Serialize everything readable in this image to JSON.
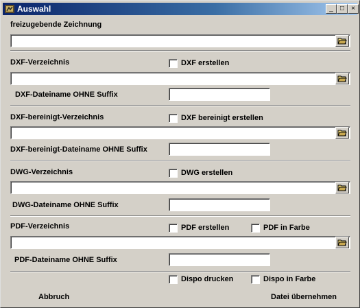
{
  "window": {
    "title": "Auswahl",
    "buttons": {
      "minimize": "_",
      "maximize": "□",
      "close": "×"
    }
  },
  "sections": {
    "zeichnung": {
      "label": "freizugebende Zeichnung",
      "path_value": ""
    },
    "dxf": {
      "dir_label": "DXF-Verzeichnis",
      "create_label": "DXF erstellen",
      "create_checked": false,
      "path_value": "",
      "filename_label": "DXF-Dateiname OHNE Suffix",
      "filename_value": ""
    },
    "dxf_bereinigt": {
      "dir_label": "DXF-bereinigt-Verzeichnis",
      "create_label": "DXF bereinigt erstellen",
      "create_checked": false,
      "path_value": "",
      "filename_label": "DXF-bereinigt-Dateiname OHNE Suffix",
      "filename_value": ""
    },
    "dwg": {
      "dir_label": "DWG-Verzeichnis",
      "create_label": "DWG erstellen",
      "create_checked": false,
      "path_value": "",
      "filename_label": "DWG-Dateiname OHNE Suffix",
      "filename_value": ""
    },
    "pdf": {
      "dir_label": "PDF-Verzeichnis",
      "create_label": "PDF erstellen",
      "create_checked": false,
      "color_label": "PDF in Farbe",
      "color_checked": false,
      "path_value": "",
      "filename_label": "PDF-Dateiname OHNE Suffix",
      "filename_value": ""
    }
  },
  "dispo": {
    "print_label": "Dispo drucken",
    "print_checked": false,
    "color_label": "Dispo in Farbe",
    "color_checked": false
  },
  "actions": {
    "cancel_label": "Abbruch",
    "accept_label": "Datei übernehmen"
  },
  "icons": {
    "app": "app-icon",
    "folder": "folder-open-icon"
  }
}
